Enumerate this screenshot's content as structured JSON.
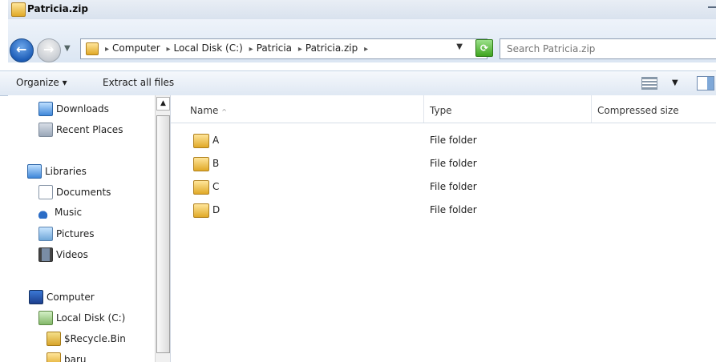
{
  "window": {
    "title": "Patricia.zip",
    "icon": "zip-folder-icon"
  },
  "nav": {
    "back_icon": "back-arrow-icon",
    "forward_icon": "forward-arrow-icon",
    "recent_dropdown": "chevron-down-icon",
    "breadcrumbs": [
      "Computer",
      "Local Disk (C:)",
      "Patricia",
      "Patricia.zip"
    ],
    "refresh_icon": "refresh-icon",
    "search_placeholder": "Search Patricia.zip"
  },
  "toolbar": {
    "organize_label": "Organize",
    "extract_label": "Extract all files",
    "view_icon": "views-icon",
    "preview_icon": "preview-pane-icon"
  },
  "navpane": {
    "items": [
      {
        "label": "Downloads",
        "icon": "downloads-folder-icon"
      },
      {
        "label": "Recent Places",
        "icon": "recent-places-icon"
      },
      {
        "label": "Libraries",
        "icon": "libraries-icon"
      },
      {
        "label": "Documents",
        "icon": "documents-icon"
      },
      {
        "label": "Music",
        "icon": "music-icon"
      },
      {
        "label": "Pictures",
        "icon": "pictures-icon"
      },
      {
        "label": "Videos",
        "icon": "videos-icon"
      },
      {
        "label": "Computer",
        "icon": "computer-icon"
      },
      {
        "label": "Local Disk (C:)",
        "icon": "local-disk-icon"
      },
      {
        "label": "$Recycle.Bin",
        "icon": "recycle-bin-icon"
      },
      {
        "label": "baru",
        "icon": "folder-icon"
      }
    ]
  },
  "list": {
    "columns": [
      "Name",
      "Type",
      "Compressed size"
    ],
    "rows": [
      {
        "name": "A",
        "type": "File folder"
      },
      {
        "name": "B",
        "type": "File folder"
      },
      {
        "name": "C",
        "type": "File folder"
      },
      {
        "name": "D",
        "type": "File folder"
      }
    ]
  }
}
